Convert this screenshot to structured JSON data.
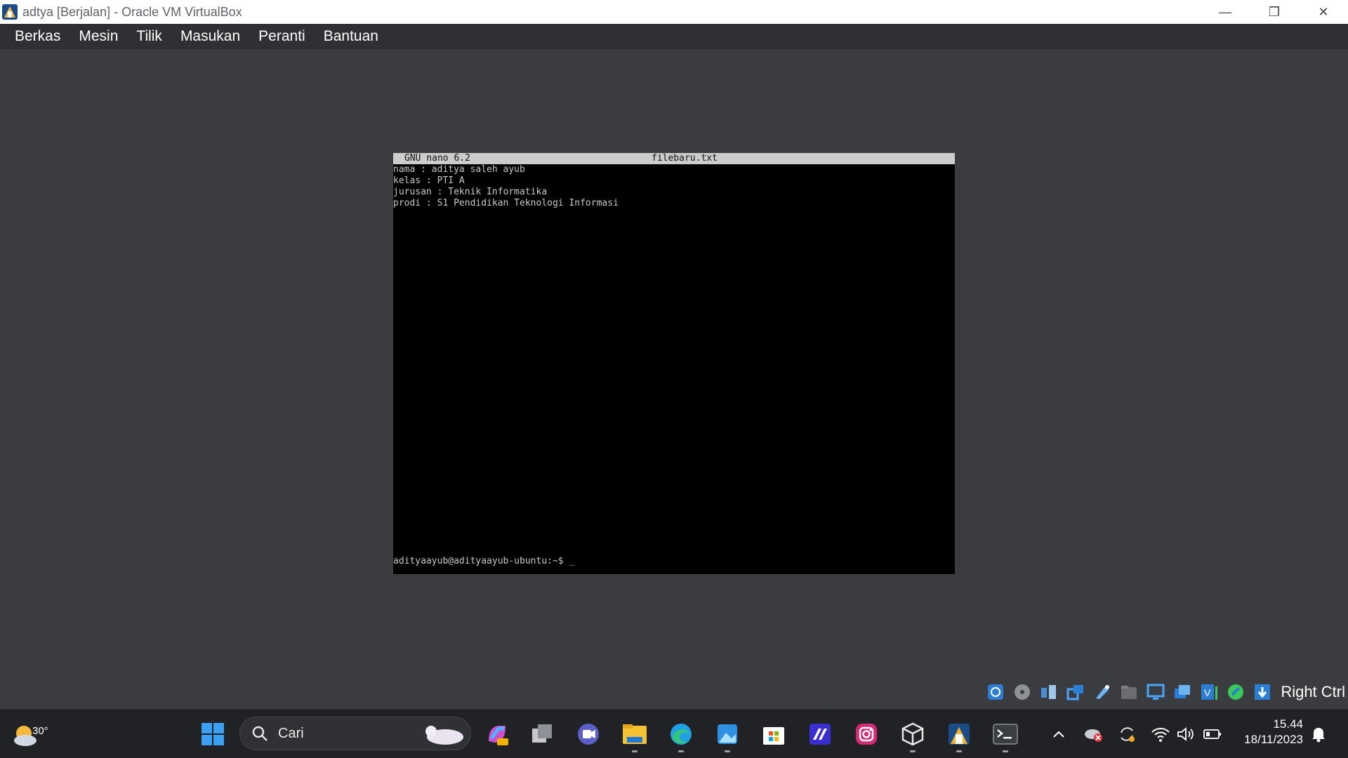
{
  "window": {
    "title": "adtya [Berjalan] - Oracle VM VirtualBox",
    "minimize_glyph": "—",
    "restore_glyph": "❐",
    "close_glyph": "✕"
  },
  "menubar": {
    "items": [
      "Berkas",
      "Mesin",
      "Tilik",
      "Masukan",
      "Peranti",
      "Bantuan"
    ]
  },
  "nano": {
    "version": "GNU nano 6.2",
    "filename": "filebaru.txt",
    "lines": [
      "nama : aditya saleh ayub",
      "kelas : PTI A",
      "jurusan : Teknik Informatika",
      "prodi : S1 Pendidikan Teknologi Informasi"
    ],
    "prompt": "adityaayub@adityaayub-ubuntu:~$ _"
  },
  "vm_status": {
    "icons": [
      "hard-disk-icon",
      "optical-drive-icon",
      "audio-icon",
      "network-icon",
      "usb-icon",
      "shared-folder-icon",
      "display-icon",
      "recording-icon",
      "vt-x-icon",
      "mouse-integration-icon",
      "keyboard-capture-icon"
    ],
    "host_key": "Right Ctrl"
  },
  "taskbar": {
    "weather_temp": "30°",
    "search_placeholder": "Cari",
    "apps": [
      "start-icon",
      "copilot-icon",
      "task-view-icon",
      "teams-icon",
      "file-explorer-icon",
      "edge-icon",
      "photos-icon",
      "store-icon",
      "visual-studio-icon",
      "instagram-icon",
      "virtualbox-icon",
      "virtualbox-vm-icon",
      "terminal-icon"
    ],
    "time": "15.44",
    "date": "18/11/2023"
  },
  "colors": {
    "vm_background": "#3b3c3f",
    "menubar": "#2f3033",
    "taskbar": "#202225",
    "nano_header": "#cccccc"
  }
}
